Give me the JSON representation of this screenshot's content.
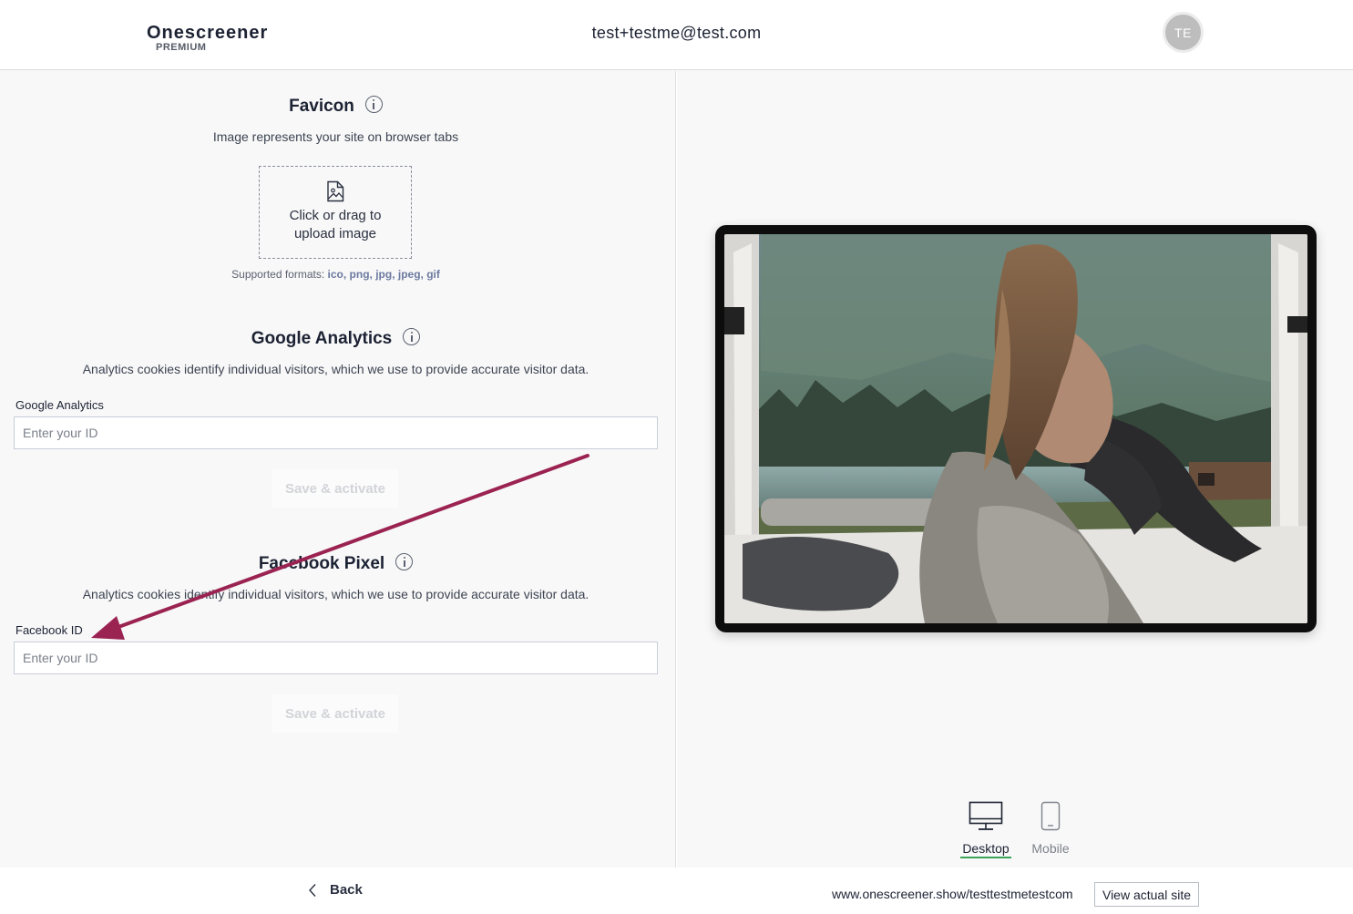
{
  "header": {
    "brand_name": "Onescreener",
    "brand_tier": "PREMIUM",
    "user_email": "test+testme@test.com",
    "avatar_initials": "TE"
  },
  "favicon": {
    "title": "Favicon",
    "description": "Image represents your site on browser tabs",
    "upload_line1": "Click or drag to",
    "upload_line2": "upload image",
    "formats_prefix": "Supported formats: ",
    "formats_list": "ico, png, jpg, jpeg, gif"
  },
  "google_analytics": {
    "title": "Google Analytics",
    "description": "Analytics cookies identify individual visitors, which we use to provide accurate visitor data.",
    "field_label": "Google Analytics",
    "placeholder": "Enter your ID",
    "value": "",
    "save_label": "Save & activate"
  },
  "facebook_pixel": {
    "title": "Facebook Pixel",
    "description": "Analytics cookies identify individual visitors, which we use to provide accurate visitor data.",
    "field_label": "Facebook ID",
    "placeholder": "Enter your ID",
    "value": "",
    "save_label": "Save & activate"
  },
  "preview": {
    "image_subject": "woman sitting in open van overlooking mountain lake",
    "views": [
      {
        "label": "Desktop",
        "icon": "monitor-icon",
        "selected": true
      },
      {
        "label": "Mobile",
        "icon": "phone-icon",
        "selected": false
      }
    ]
  },
  "footer": {
    "back_label": "Back",
    "site_url": "www.onescreener.show/testtestmetestcom",
    "view_site_label": "View actual site"
  },
  "colors": {
    "annotation_arrow": "#9b2352",
    "selected_underline": "#3aa35a",
    "panel_background": "#f8f8f8"
  }
}
